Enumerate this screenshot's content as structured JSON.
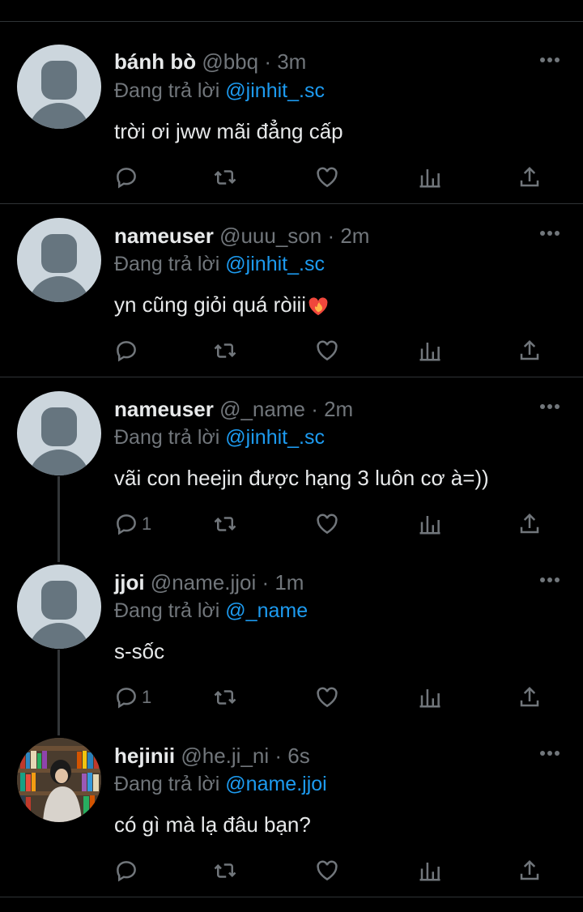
{
  "tweets": [
    {
      "name": "bánh bò",
      "handle": "@bbq · 3m",
      "reply_prefix": "Đang trả lời",
      "reply_to": "@jinhit_.sc",
      "text": "trời ơi jww mãi đẳng cấp",
      "reply_count": ""
    },
    {
      "name": "nameuser",
      "handle": "@uuu_son · 2m",
      "reply_prefix": "Đang trả lời",
      "reply_to": "@jinhit_.sc",
      "text": "yn cũng giỏi quá ròiii",
      "emoji": "heart-on-fire",
      "reply_count": ""
    },
    {
      "name": "nameuser",
      "handle": "@_name · 2m",
      "reply_prefix": "Đang trả lời",
      "reply_to": "@jinhit_.sc",
      "text": "vãi con heejin được hạng 3 luôn cơ à=))",
      "reply_count": "1"
    },
    {
      "name": "jjoi",
      "handle": "@name.jjoi · 1m",
      "reply_prefix": "Đang trả lời",
      "reply_to": "@_name",
      "text": "s-sốc",
      "reply_count": "1"
    },
    {
      "name": "hejinii",
      "handle": "@he.ji_ni · 6s",
      "reply_prefix": "Đang trả lời",
      "reply_to": "@name.jjoi",
      "text": "có gì mà lạ đâu bạn?",
      "reply_count": "",
      "avatar": "photo"
    }
  ],
  "colors": {
    "background": "#000000",
    "text": "#e7e9ea",
    "muted": "#71767b",
    "accent": "#1d9bf0",
    "divider": "#2f3336"
  },
  "icons": [
    "reply-icon",
    "retweet-icon",
    "like-icon",
    "views-icon",
    "share-icon",
    "more-icon"
  ]
}
